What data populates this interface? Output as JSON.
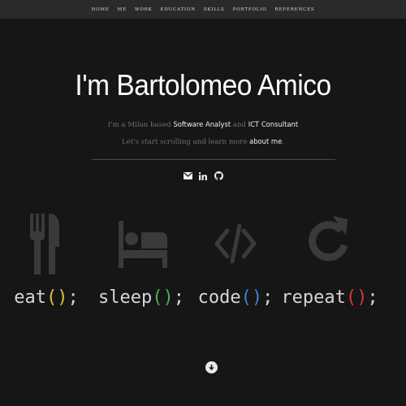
{
  "nav": {
    "items": [
      "HOME",
      "ME",
      "WORK",
      "EDUCATION",
      "SKILLS",
      "PORTFOLIO",
      "REFERENCES"
    ]
  },
  "hero": {
    "title": "I'm Bartolomeo Amico",
    "intro": {
      "part1": "I'm a Milan based ",
      "role1": "Software Analyst",
      "and": " and ",
      "role2": "ICT Consultant",
      "part2": " Let's start scrolling and learn more ",
      "link": "about me",
      "end": "."
    }
  },
  "socials": [
    {
      "icon": "envelope-icon"
    },
    {
      "icon": "linkedin-icon"
    },
    {
      "icon": "github-icon"
    }
  ],
  "activities": [
    {
      "word": "eat",
      "open": "(",
      "close": ")",
      "semi": ";",
      "paren_color": "#d4c43b",
      "icon": "fork-knife-icon"
    },
    {
      "word": "sleep",
      "open": "(",
      "close": ")",
      "semi": ";",
      "paren_color": "#4caf50",
      "icon": "bed-icon"
    },
    {
      "word": "code",
      "open": "(",
      "close": ")",
      "semi": ";",
      "paren_color": "#3f7fd8",
      "icon": "code-icon"
    },
    {
      "word": "repeat",
      "open": "(",
      "close": ")",
      "semi": ";",
      "paren_color": "#d03a3a",
      "icon": "repeat-icon"
    }
  ],
  "colors": {
    "background": "#161616",
    "navbar": "#2a2a2a",
    "icon_gray": "#3a3a3a"
  }
}
